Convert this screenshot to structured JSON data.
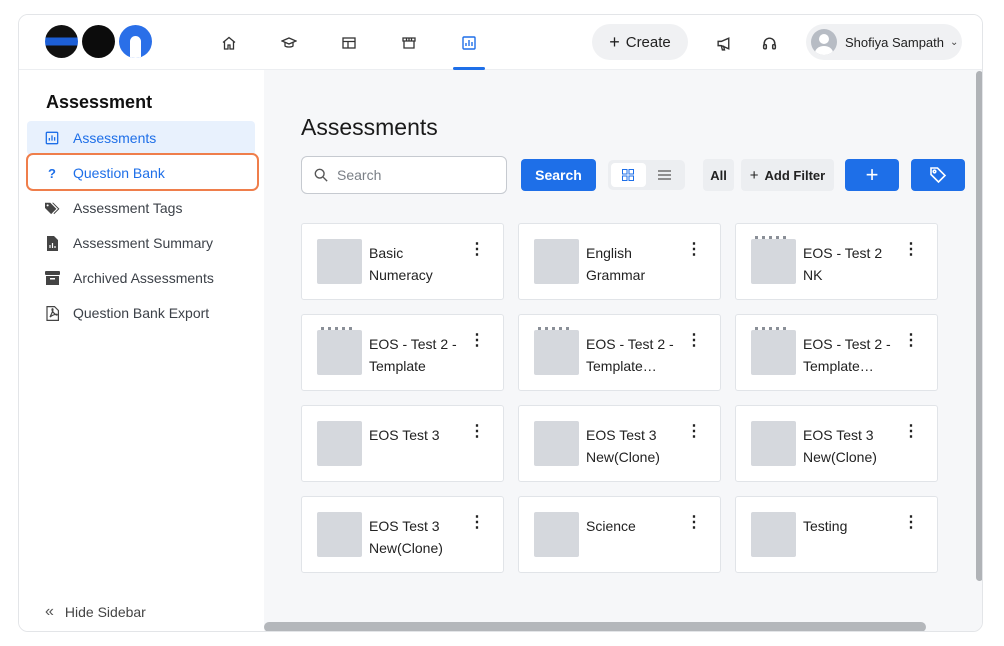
{
  "topbar": {
    "create_label": "Create",
    "user_name": "Shofiya Sampath",
    "nav_icons": [
      "home-icon",
      "graduation-cap-icon",
      "dashboard-icon",
      "store-icon",
      "analytics-icon"
    ],
    "active_nav": "analytics-icon"
  },
  "sidebar": {
    "title": "Assessment",
    "items": [
      {
        "label": "Assessments",
        "icon": "bar-chart-icon",
        "state": "active"
      },
      {
        "label": "Question Bank",
        "icon": "question-icon",
        "state": "highlighted"
      },
      {
        "label": "Assessment Tags",
        "icon": "tags-icon",
        "state": "normal"
      },
      {
        "label": "Assessment Summary",
        "icon": "summary-doc-icon",
        "state": "normal"
      },
      {
        "label": "Archived Assessments",
        "icon": "archive-icon",
        "state": "normal"
      },
      {
        "label": "Question Bank Export",
        "icon": "pdf-icon",
        "state": "normal"
      }
    ],
    "hide_label": "Hide Sidebar"
  },
  "main": {
    "title": "Assessments",
    "search": {
      "placeholder": "Search",
      "value": ""
    },
    "search_button": "Search",
    "filter_all": "All",
    "add_filter": "Add Filter",
    "view_mode": "grid",
    "cards": [
      {
        "title": "Basic Numeracy"
      },
      {
        "title": "English Grammar"
      },
      {
        "title": "EOS - Test 2 NK"
      },
      {
        "title": "EOS - Test 2 - Template"
      },
      {
        "title": "EOS - Test 2 - Template…"
      },
      {
        "title": "EOS - Test 2 - Template…"
      },
      {
        "title": "EOS Test 3"
      },
      {
        "title": "EOS Test 3 New(Clone)"
      },
      {
        "title": "EOS Test 3 New(Clone)"
      },
      {
        "title": "EOS Test 3 New(Clone)"
      },
      {
        "title": "Science"
      },
      {
        "title": "Testing"
      }
    ]
  },
  "colors": {
    "accent": "#1e6fe8",
    "active_bg": "#e8f1fd",
    "highlight_outline": "#ef7e4b"
  }
}
